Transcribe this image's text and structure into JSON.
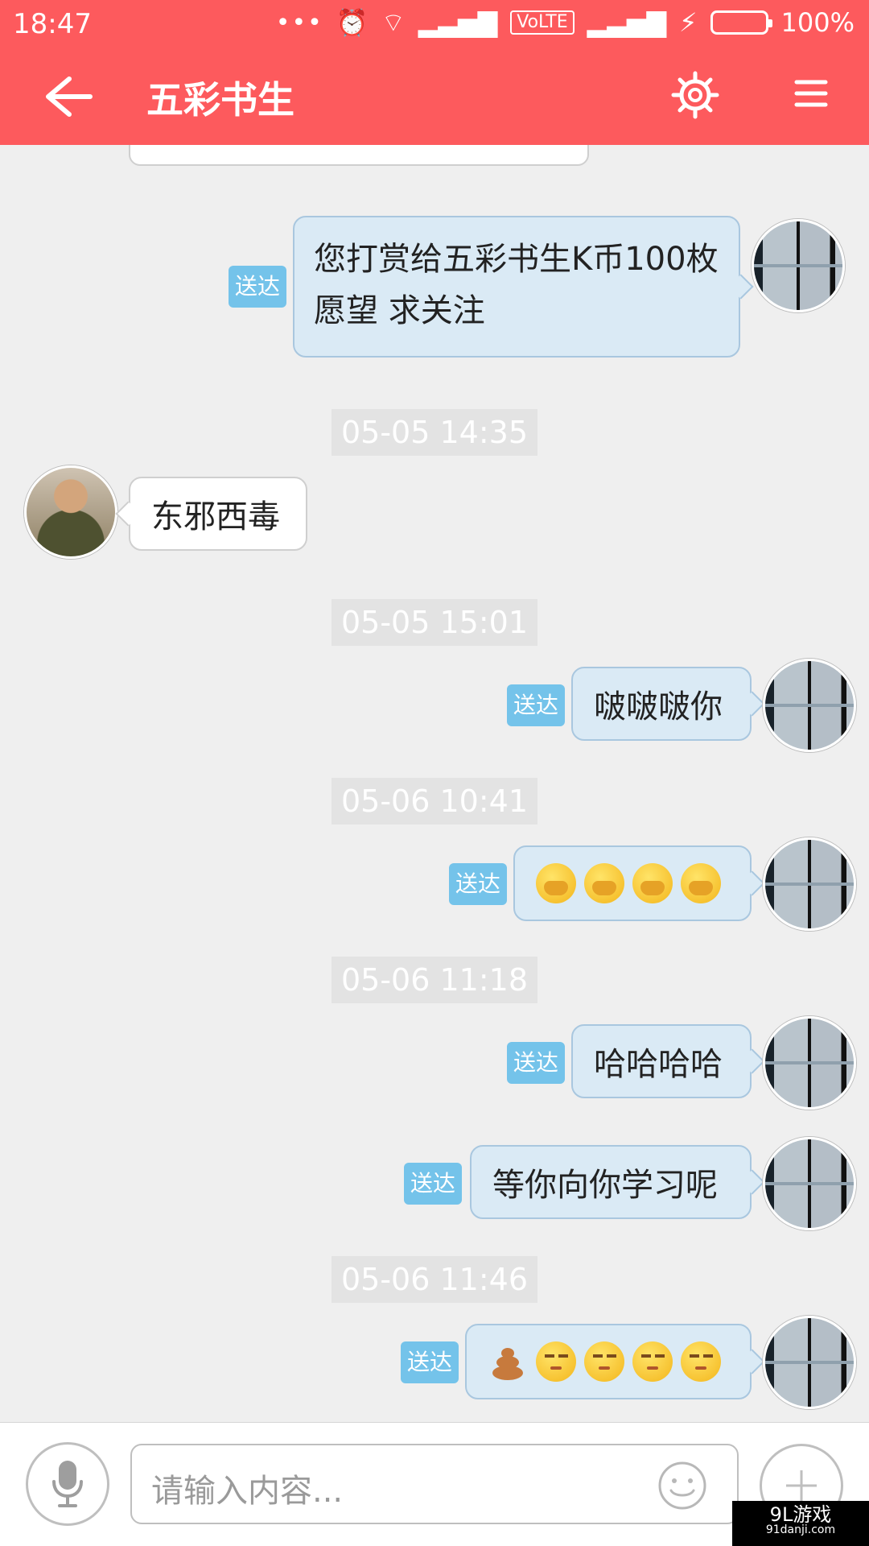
{
  "status_bar": {
    "time": "18:47",
    "network": "VoLTE",
    "battery": "100%"
  },
  "header": {
    "title": "五彩书生"
  },
  "messages": [
    {
      "type": "timestamp",
      "text": "05-05 14:35"
    },
    {
      "type": "in",
      "text": "东邪西毒"
    },
    {
      "type": "timestamp",
      "text": "05-05 15:01"
    },
    {
      "type": "out",
      "text": "啵啵啵你",
      "status": "送达"
    },
    {
      "type": "timestamp",
      "text": "05-06 10:41"
    },
    {
      "type": "out",
      "text": "",
      "status": "送达",
      "emojis": [
        "hugging",
        "hugging",
        "hugging",
        "hugging"
      ]
    },
    {
      "type": "timestamp",
      "text": "05-06 11:18"
    },
    {
      "type": "out",
      "text": "哈哈哈哈",
      "status": "送达"
    },
    {
      "type": "out",
      "text": "等你向你学习呢",
      "status": "送达"
    },
    {
      "type": "timestamp",
      "text": "05-06 11:46"
    },
    {
      "type": "out",
      "text": "",
      "status": "送达",
      "emojis": [
        "poop",
        "unamused",
        "unamused",
        "unamused",
        "unamused"
      ]
    }
  ],
  "first_message": {
    "line1": "您打赏给五彩书生K币100枚",
    "line2": "愿望 求关注",
    "status": "送达"
  },
  "input": {
    "placeholder": "请输入内容..."
  },
  "watermark": {
    "line1": "9L游戏",
    "line2": "91danji.com"
  },
  "colors": {
    "accent": "#fd5a5d",
    "outgoing_bubble": "#daeaf5",
    "delivered_badge": "#74c3ea"
  }
}
